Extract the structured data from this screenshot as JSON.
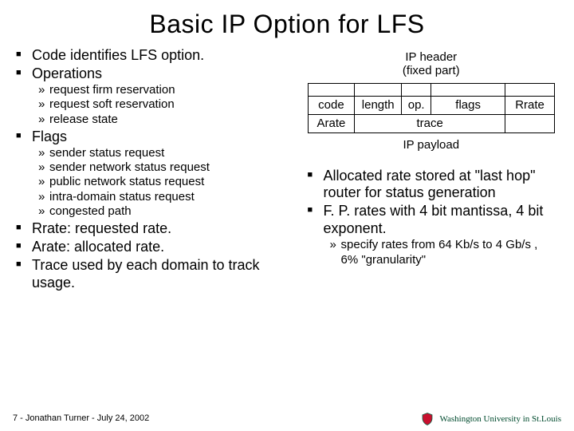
{
  "title": "Basic IP Option for LFS",
  "left": {
    "b1": "Code identifies LFS option.",
    "b2": "Operations",
    "b2s": [
      "request firm reservation",
      "request soft reservation",
      "release state"
    ],
    "b3": "Flags",
    "b3s": [
      "sender status request",
      "sender network status request",
      "public network status request",
      "intra-domain status request",
      "congested path"
    ],
    "b4": "Rrate: requested rate.",
    "b5": "Arate: allocated rate.",
    "b6": "Trace used by each domain to track usage."
  },
  "diagram": {
    "hdr1": "IP header",
    "hdr2": "(fixed part)",
    "cells": {
      "code": "code",
      "length": "length",
      "op": "op.",
      "flags": "flags",
      "rrate": "Rrate",
      "arate": "Arate",
      "trace": "trace"
    },
    "payload": "IP payload"
  },
  "right": {
    "b1": "Allocated rate stored at \"last hop\" router for status generation",
    "b2": "F. P. rates with 4 bit mantissa, 4 bit exponent.",
    "b2s": "specify rates from 64 Kb/s to 4 Gb/s , 6% \"granularity\""
  },
  "footer": "7 - Jonathan Turner - July 24, 2002",
  "logo_text": "Washington University in St.Louis"
}
